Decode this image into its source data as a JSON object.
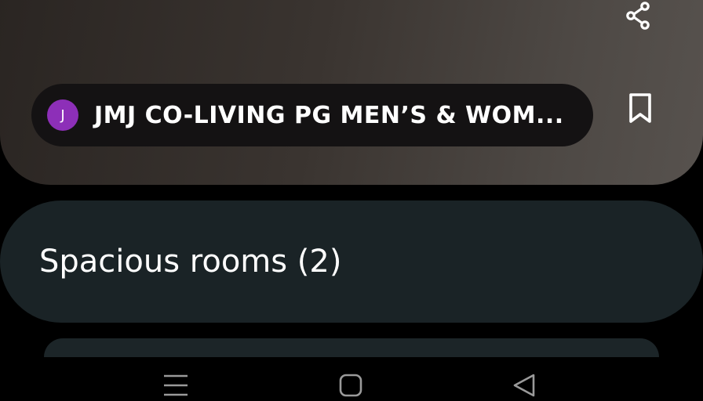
{
  "result": {
    "source_avatar_letter": "J",
    "source_title": "JMJ CO-LIVING PG MEN’S & WOM...",
    "share_icon": "share-icon",
    "bookmark_icon": "bookmark-icon"
  },
  "related": {
    "label": "Spacious rooms (2)"
  },
  "nav": {
    "recents_icon": "menu-lines-icon",
    "home_icon": "rounded-square-icon",
    "back_icon": "triangle-back-icon"
  },
  "colors": {
    "avatar": "#8d2fb8",
    "related_card": "#1a2326",
    "source_chip": "#141213"
  }
}
